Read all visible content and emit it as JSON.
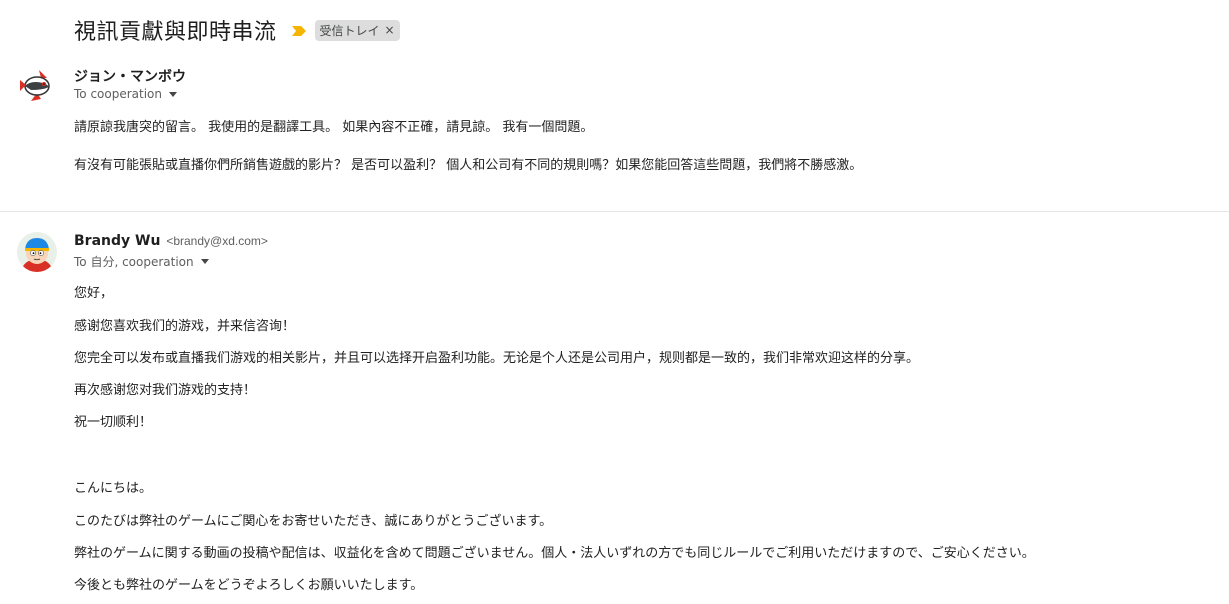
{
  "thread": {
    "subject": "視訊貢獻與即時串流",
    "label": "受信トレイ",
    "label_close": "×",
    "importance_icon": "importance-marker-icon",
    "importance_color": "#f4b400"
  },
  "messages": [
    {
      "sender_name": "ジョン・マンボウ",
      "sender_email": "",
      "recipients": "To cooperation",
      "avatar": "fish-avatar",
      "paragraphs": [
        "請原諒我唐突的留言。 我使用的是翻譯工具。 如果內容不正確，請見諒。 我有一個問題。",
        "有沒有可能張貼或直播你們所銷售遊戲的影片？ 是否可以盈利？ 個人和公司有不同的規則嗎？如果您能回答這些問題，我們將不勝感激。"
      ]
    },
    {
      "sender_name": "Brandy Wu",
      "sender_email": "<brandy@xd.com>",
      "recipients": "To 自分, cooperation",
      "avatar": "cartoon-boy-avatar",
      "paragraphs": [
        "您好，",
        "感谢您喜欢我们的游戏，并来信咨询！",
        "您完全可以发布或直播我们游戏的相关影片，并且可以选择开启盈利功能。无论是个人还是公司用户，规则都是一致的，我们非常欢迎这样的分享。",
        "再次感谢您对我们游戏的支持！",
        "祝一切顺利！",
        "こんにちは。",
        "このたびは弊社のゲームにご関心をお寄せいただき、誠にありがとうございます。",
        "弊社のゲームに関する動画の投稿や配信は、収益化を含めて問題ございません。個人・法人いずれの方でも同じルールでご利用いただけますので、ご安心ください。",
        "今後とも弊社のゲームをどうぞよろしくお願いいたします。"
      ]
    }
  ]
}
